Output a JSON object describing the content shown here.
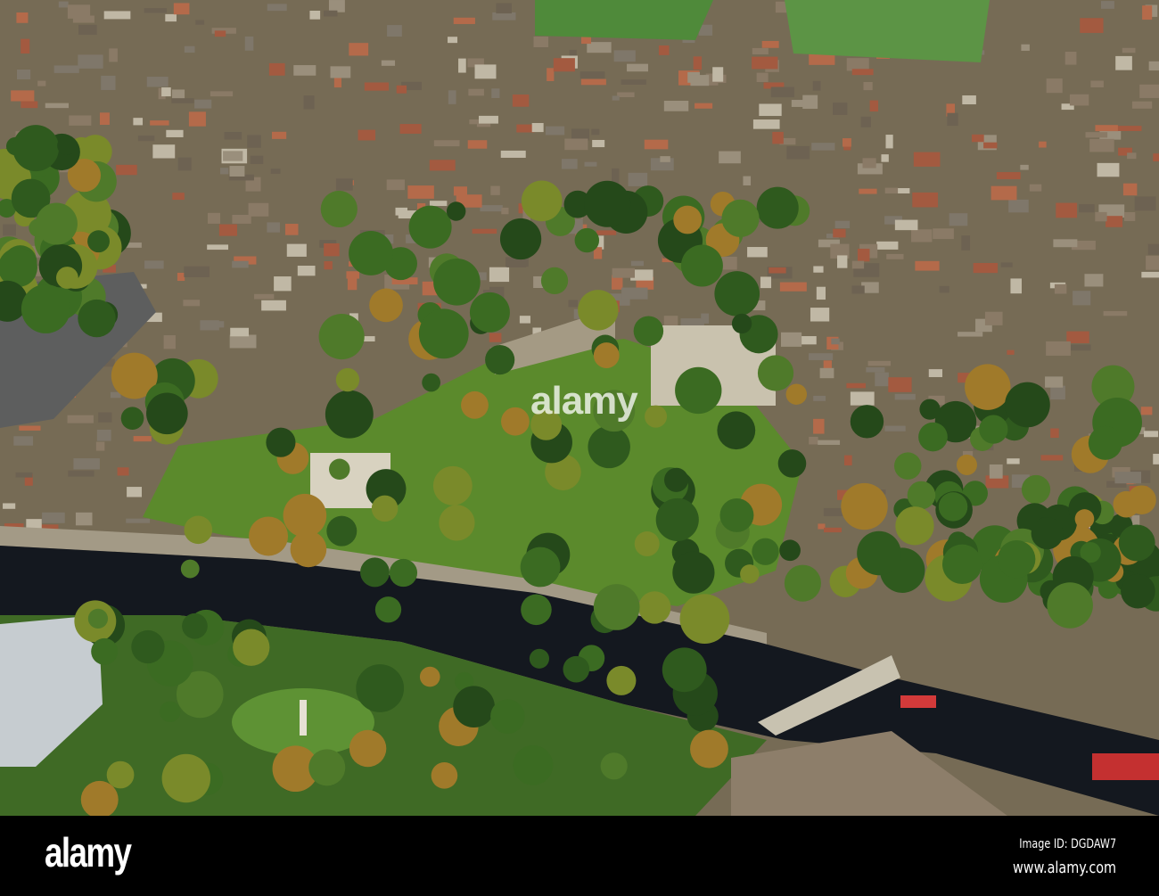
{
  "photo": {
    "subject": "Aerial view of riverside park with abbey ruins and city",
    "watermark_text": "alamy",
    "watermark_mark": "a"
  },
  "footer": {
    "logo": "alamy",
    "image_id": "Image ID: DGDAW7",
    "url": "www.alamy.com"
  },
  "colors": {
    "urban": "#7a6e58",
    "park": "#5d8a2e",
    "river": "#14181f",
    "trees": "#2f5a1e"
  }
}
